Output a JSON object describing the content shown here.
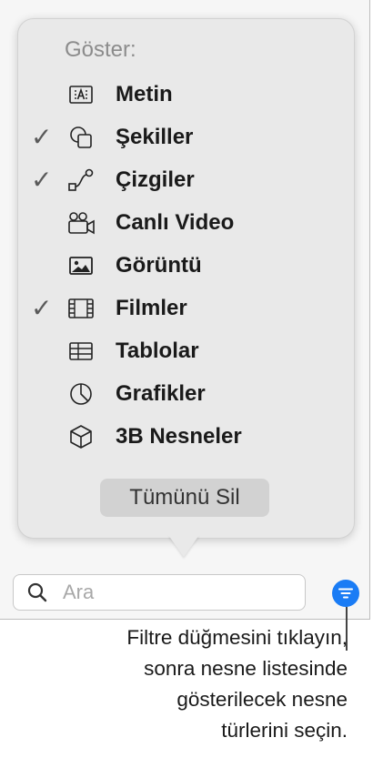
{
  "popover": {
    "title": "Göster:",
    "items": [
      {
        "label": "Metin",
        "checked": false,
        "icon": "text-box-icon"
      },
      {
        "label": "Şekiller",
        "checked": true,
        "icon": "shapes-icon"
      },
      {
        "label": "Çizgiler",
        "checked": true,
        "icon": "lines-icon"
      },
      {
        "label": "Canlı Video",
        "checked": false,
        "icon": "live-video-icon"
      },
      {
        "label": "Görüntü",
        "checked": false,
        "icon": "image-icon"
      },
      {
        "label": "Filmler",
        "checked": true,
        "icon": "film-icon"
      },
      {
        "label": "Tablolar",
        "checked": false,
        "icon": "table-icon"
      },
      {
        "label": "Grafikler",
        "checked": false,
        "icon": "chart-icon"
      },
      {
        "label": "3B Nesneler",
        "checked": false,
        "icon": "cube-3d-icon"
      }
    ],
    "check_mark": "✓",
    "clear_all_label": "Tümünü Sil"
  },
  "search": {
    "placeholder": "Ara",
    "value": ""
  },
  "filter_button": {
    "icon": "filter-icon",
    "color": "#1a7cf5"
  },
  "caption": "Filtre düğmesini tıklayın,\nsonra nesne listesinde\ngösterilecek nesne\ntürlerini seçin."
}
